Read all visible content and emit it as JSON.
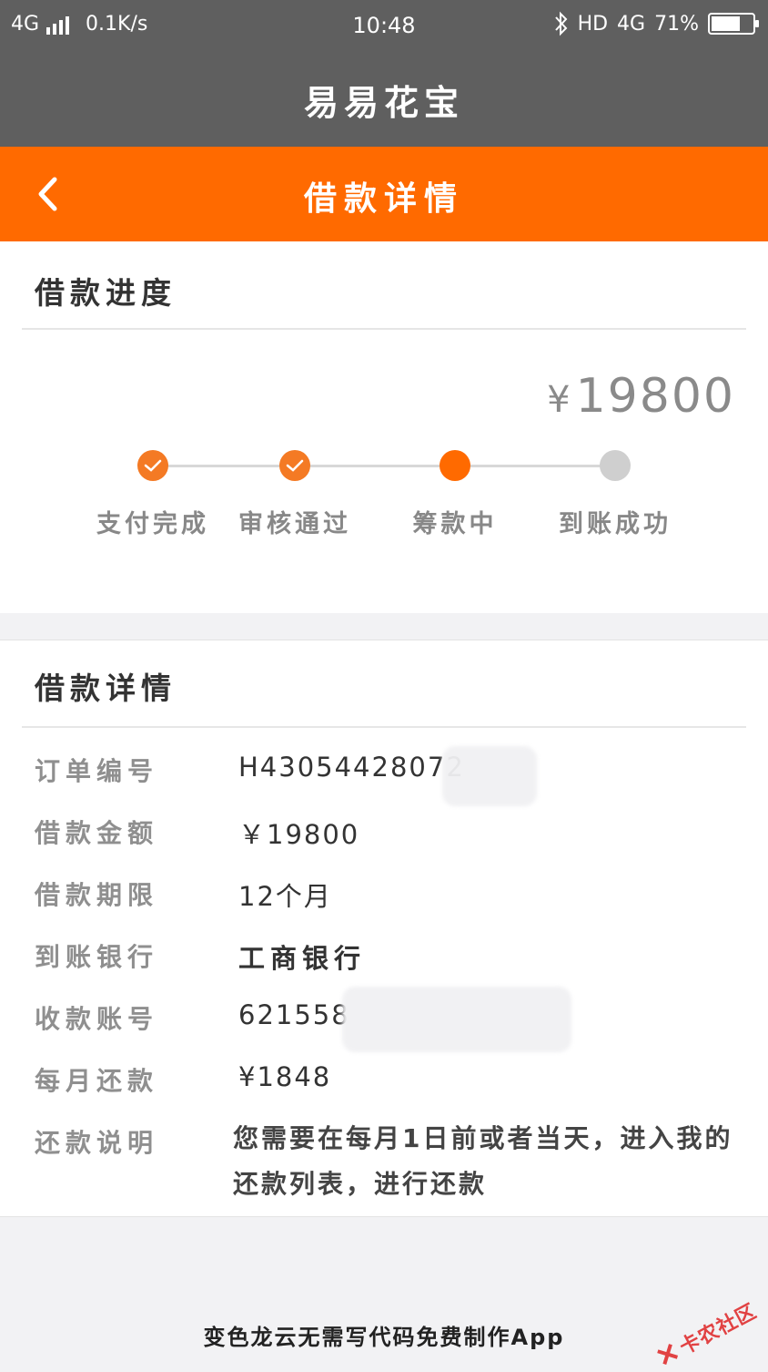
{
  "status_bar": {
    "network": "4G",
    "speed": "0.1K/s",
    "time": "10:48",
    "hd": "HD",
    "network2": "4G",
    "battery": "71%",
    "battery_level": 0.71
  },
  "app": {
    "title": "易易花宝"
  },
  "nav": {
    "title": "借款详情",
    "back_icon": "chevron-left-icon"
  },
  "progress": {
    "section_title": "借款进度",
    "amount_symbol": "¥",
    "amount": "19800",
    "steps": [
      {
        "label": "支付完成",
        "state": "done"
      },
      {
        "label": "审核通过",
        "state": "done"
      },
      {
        "label": "筹款中",
        "state": "active"
      },
      {
        "label": "到账成功",
        "state": "pending"
      }
    ]
  },
  "details": {
    "section_title": "借款详情",
    "rows": [
      {
        "label": "订单编号",
        "value": "H43054428072"
      },
      {
        "label": "借款金额",
        "value": "￥19800"
      },
      {
        "label": "借款期限",
        "value": "12个月"
      },
      {
        "label": "到账银行",
        "value": "工商银行"
      },
      {
        "label": "收款账号",
        "value": "621558"
      },
      {
        "label": "每月还款",
        "value": "¥1848"
      },
      {
        "label": "还款说明",
        "value": "您需要在每月1日前或者当天，进入我的还款列表，进行还款"
      }
    ]
  },
  "footer": {
    "text": "变色龙云无需写代码免费制作App"
  },
  "watermark": {
    "text": "卡农社区"
  },
  "colors": {
    "accent": "#ff6a00",
    "header": "#5f5f5f",
    "done": "#f47a24",
    "pending": "#cfcfcf"
  }
}
